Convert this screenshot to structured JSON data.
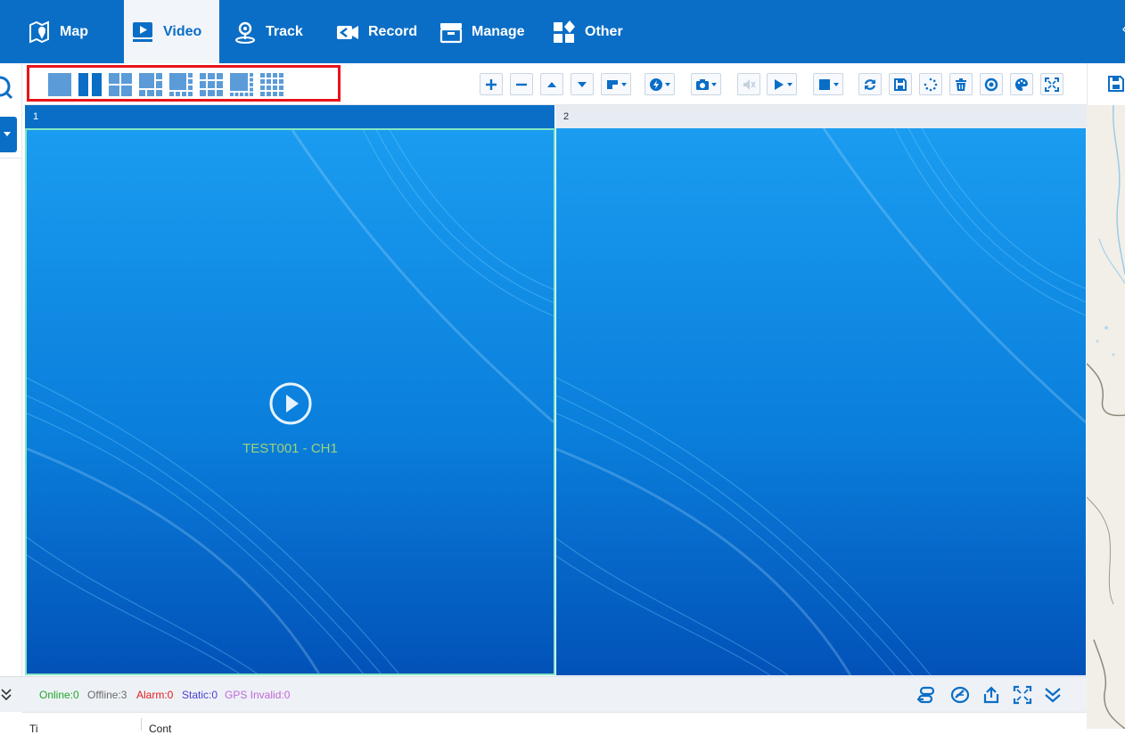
{
  "nav": {
    "items": [
      {
        "label": "Map",
        "icon": "map-pin-icon",
        "active": false
      },
      {
        "label": "Video",
        "icon": "video-play-icon",
        "active": true
      },
      {
        "label": "Track",
        "icon": "location-track-icon",
        "active": false
      },
      {
        "label": "Record",
        "icon": "video-record-icon",
        "active": false
      },
      {
        "label": "Manage",
        "icon": "manage-box-icon",
        "active": false
      },
      {
        "label": "Other",
        "icon": "grid-shapes-icon",
        "active": false
      }
    ],
    "collapse_icon": "chevron-left-icon"
  },
  "toolbar": {
    "layout_icons": [
      "layout-1-icon",
      "layout-2-icon",
      "layout-4-icon",
      "layout-6-icon",
      "layout-8-icon",
      "layout-9-icon",
      "layout-10-icon",
      "layout-16-icon"
    ],
    "action_icons": [
      "plus-icon",
      "minus-icon",
      "arrow-up-icon",
      "arrow-down-icon",
      "window-menu-icon",
      "speed-menu-icon",
      "camera-menu-icon",
      "mute-icon",
      "play-menu-icon",
      "stop-menu-icon",
      "refresh-icon",
      "save-icon",
      "loading-icon",
      "trash-icon",
      "target-icon",
      "palette-icon",
      "fullscreen-icon"
    ]
  },
  "panes": [
    {
      "number": "1",
      "channel": "TEST001 - CH1",
      "selected": true
    },
    {
      "number": "2",
      "channel": "",
      "selected": false
    }
  ],
  "status": {
    "online": "Online:0",
    "offline": "Offline:3",
    "alarm": "Alarm:0",
    "static": "Static:0",
    "gps_invalid": "GPS Invalid:0"
  },
  "status_icons": [
    "route-icon",
    "eraser-icon",
    "export-icon",
    "fullscreen-icon",
    "collapse-down-icon"
  ],
  "table": {
    "col1": "Ti",
    "col2": "Cont"
  },
  "colors": {
    "brand": "#0a6ec6",
    "selected_border": "#82e7c4",
    "highlight_box": "#e8141b",
    "channel_text": "#9dd37a"
  }
}
